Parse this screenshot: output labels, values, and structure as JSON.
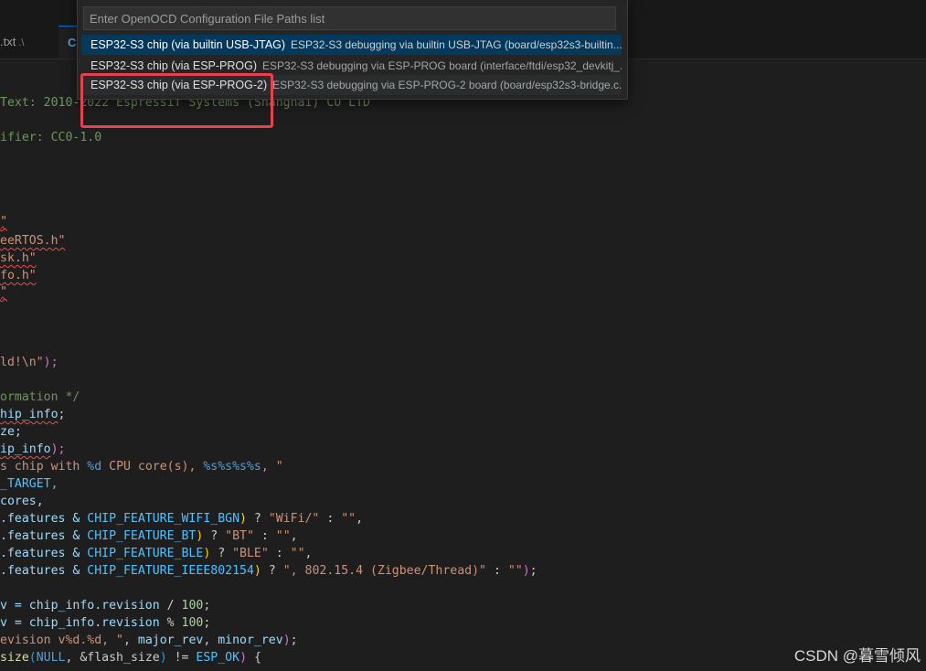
{
  "tabs": [
    {
      "label": ".txt",
      "dir": ".\\"
    },
    {
      "label": "C"
    }
  ],
  "quick_pick": {
    "placeholder": "Enter OpenOCD Configuration File Paths list",
    "items": [
      {
        "label": "ESP32-S3 chip (via builtin USB-JTAG)",
        "description": "ESP32-S3 debugging via builtin USB-JTAG (board/esp32s3-builtin..."
      },
      {
        "label": "ESP32-S3 chip (via ESP-PROG)",
        "description": "ESP32-S3 debugging via ESP-PROG board (interface/ftdi/esp32_devkitj_..."
      },
      {
        "label": "ESP32-S3 chip (via ESP-PROG-2)",
        "description": "ESP32-S3 debugging via ESP-PROG-2 board (board/esp32s3-bridge.c..."
      }
    ]
  },
  "code": {
    "l1": "Text: 2010-2022 Espressif Systems (Shanghai) CO LTD",
    "l2": "ifier: CC0-1.0",
    "inc1": "\"",
    "inc2": "eeRTOS.h\"",
    "inc3": "sk.h\"",
    "inc4": "fo.h\"",
    "inc5": "\"",
    "hello": "ld!\\n\"",
    "hello_end": ");",
    "cm_info": "ormation */",
    "chip_info": "hip_info",
    "size_tail": "ze;",
    "ip_info": "ip_info",
    "ip_end": ");",
    "s_prefix": "s ",
    "s_chip": "chip with ",
    "s_fmt_d": "%d",
    "s_cpu": " CPU core(s), ",
    "s_fmt_s": "%s%s%s%s",
    "s_tail": ", \"",
    "target": "_TARGET,",
    "cores": "cores,",
    "feat_dot": ".features & ",
    "wifi_mac": "CHIP_FEATURE_WIFI_BGN",
    "wifi_str": "\"WiFi/\"",
    "bt_mac": "CHIP_FEATURE_BT",
    "bt_str": "\"BT\"",
    "ble_mac": "CHIP_FEATURE_BLE",
    "ble_str": "\"BLE\"",
    "ieee_mac": "CHIP_FEATURE_IEEE802154",
    "ieee_str": "\", 802.15.4 (Zigbee/Thread)\"",
    "empty_str": "\"\"",
    "q": " ? ",
    "colon": " : ",
    "rev_v": "v = ",
    "rev_expr": "chip_info.revision",
    "div": " / ",
    "mod": " % ",
    "hundred": "100",
    "semi": ";",
    "evision": "evision v%d.%d, \"",
    "major_rev": "major_rev",
    "minor_rev": "minor_rev",
    "size_fn": "size",
    "null_kw": "NULL",
    "flash": ", &flash_size",
    "neq": " != ",
    "esp_ok": "ESP_OK",
    "brace": " {"
  },
  "watermark": "CSDN @暮雪倾风",
  "colors": {
    "selection": "#04395e",
    "highlight_box": "#e8414d",
    "comment": "#6a9955",
    "string": "#ce9178"
  }
}
